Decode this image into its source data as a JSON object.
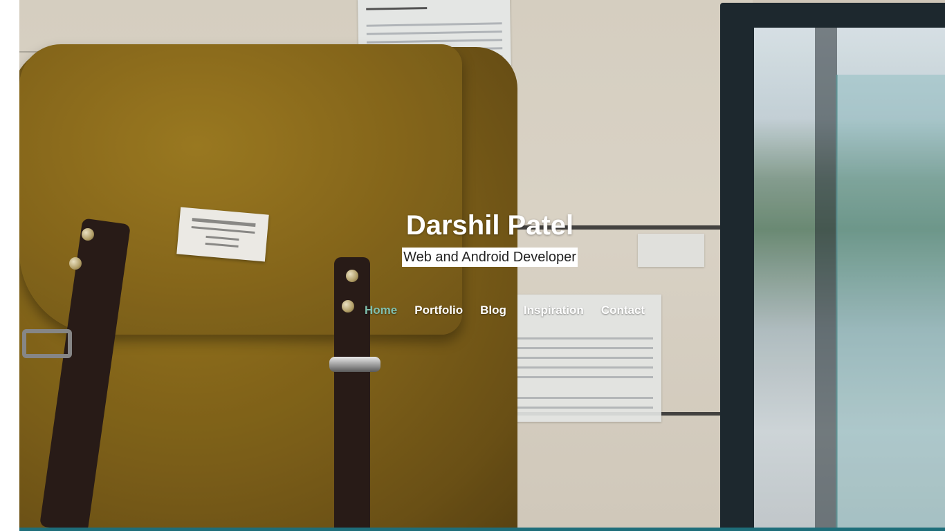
{
  "site": {
    "title": "Darshil Patel",
    "tagline": "Web and Android Developer"
  },
  "nav": {
    "items": [
      {
        "label": "Home",
        "active": true
      },
      {
        "label": "Portfolio",
        "active": false
      },
      {
        "label": "Blog",
        "active": false
      },
      {
        "label": "Inspiration",
        "active": false
      },
      {
        "label": "Contact",
        "active": false
      }
    ],
    "active_color": "#7fbfae",
    "text_color": "#ffffff"
  },
  "colors": {
    "bottom_bar": "#1e6e7a",
    "tagline_bg": "#ffffff"
  }
}
